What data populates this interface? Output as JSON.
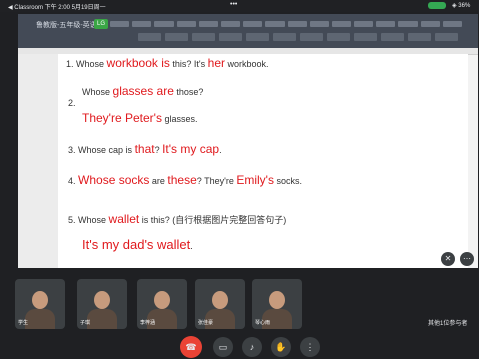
{
  "statusbar": {
    "left_text": "◀ Classroom  下午 2:00  5月19日周一",
    "center_text": "•••",
    "right_text": "◈ 36%"
  },
  "doc": {
    "filename": "鲁教版-五年级-英语 ▸",
    "badge": "LG",
    "lines": {
      "l1": {
        "num": "1.",
        "pre": "Whose ",
        "r1": "workbook is",
        "mid": " this? It's ",
        "r2": "her",
        "post": " workbook."
      },
      "l2": {
        "pre": "Whose ",
        "r1": "glasses are",
        "post": " those?"
      },
      "l2num": "2.",
      "l3": {
        "r1": "They're Peter's",
        "post": " glasses."
      },
      "l4": {
        "num": "3.",
        "pre": "Whose cap is ",
        "r1": "that",
        "mid": "? ",
        "r2": "It's my cap",
        "post": "."
      },
      "l5": {
        "num": "4.",
        "r1": "Whose socks",
        "mid1": " are ",
        "r2": "these",
        "mid2": "? They're ",
        "r3": "Emily's",
        "post": " socks."
      },
      "l6": {
        "num": "5.",
        "pre": "Whose ",
        "r1": "wallet",
        "mid": " is this? ",
        "post": "(自行根据图片完整回答句子)"
      },
      "l7": {
        "r1": "It's my dad's wallet",
        "post": "."
      }
    }
  },
  "participants": [
    {
      "name": "学生"
    },
    {
      "name": "子琪"
    },
    {
      "name": "李梓涵"
    },
    {
      "name": "张佳豪"
    },
    {
      "name": "琴心雨"
    }
  ],
  "others_label": "其他1位参与者",
  "icons": {
    "mic_off": "mic-off-icon",
    "more": "more-icon",
    "hangup": "hangup-icon",
    "camera": "camera-icon",
    "mic": "mic-icon",
    "hand": "raise-hand-icon",
    "options": "options-icon"
  },
  "colors": {
    "accent_red": "#e0191d",
    "hangup": "#ea4335",
    "badge_green": "#3aa545"
  }
}
